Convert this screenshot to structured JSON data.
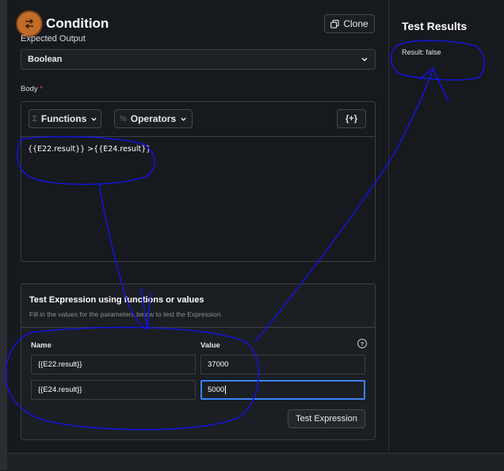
{
  "header": {
    "title": "Condition",
    "clone_label": "Clone",
    "icon": "condition-icon"
  },
  "expected_output": {
    "label": "Expected Output",
    "value": "Boolean"
  },
  "body": {
    "label": "Body",
    "required_mark": "*",
    "toolbar": {
      "functions_label": "Functions",
      "operators_label": "Operators",
      "insert_label": "{+}"
    },
    "expression": "{{E22.result}} >{{E24.result}}"
  },
  "test": {
    "title": "Test Expression using functions or values",
    "subtitle": "Fill in the values for the parameters below to test the Expression.",
    "col_name": "Name",
    "col_value": "Value",
    "help_icon": "?",
    "rows": [
      {
        "name": "{{E22.result}}",
        "value": "37000"
      },
      {
        "name": "{{E24.result}}",
        "value": "5000"
      }
    ],
    "button_label": "Test Expression"
  },
  "results": {
    "title": "Test Results",
    "result_text": "Result: false"
  },
  "annotation": {
    "color": "#1414d4"
  }
}
